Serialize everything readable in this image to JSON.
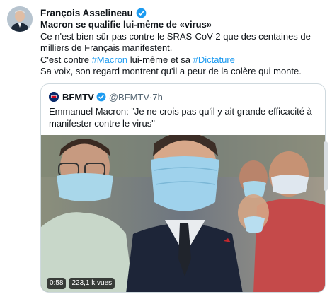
{
  "author": {
    "name": "François Asselineau",
    "verified_icon": "verified-badge-icon"
  },
  "tweet": {
    "headline": "Macron se qualifie lui-même de «virus»",
    "line1": "Ce n'est bien sûr pas contre le SRAS-CoV-2 que des centaines de milliers de Français manifestent.",
    "line2_prefix": "C'est contre ",
    "line2_hashtag1": "#Macron",
    "line2_middle": " lui-même et sa ",
    "line2_hashtag2": "#Dictature",
    "line3": "Sa voix, son regard montrent qu'il a peur de la colère qui monte."
  },
  "quoted": {
    "name": "BFMTV",
    "handle": "@BFMTV",
    "separator": " · ",
    "time": "7h",
    "text": "Emmanuel Macron: \"Je ne crois pas qu'il y ait grande efficacité à manifester contre le virus\"",
    "video": {
      "duration": "0:58",
      "views": "223,1 k vues"
    }
  },
  "colors": {
    "accent": "#1d9bf0",
    "text": "#0f1419",
    "secondary": "#536471",
    "border": "#cfd9de"
  }
}
